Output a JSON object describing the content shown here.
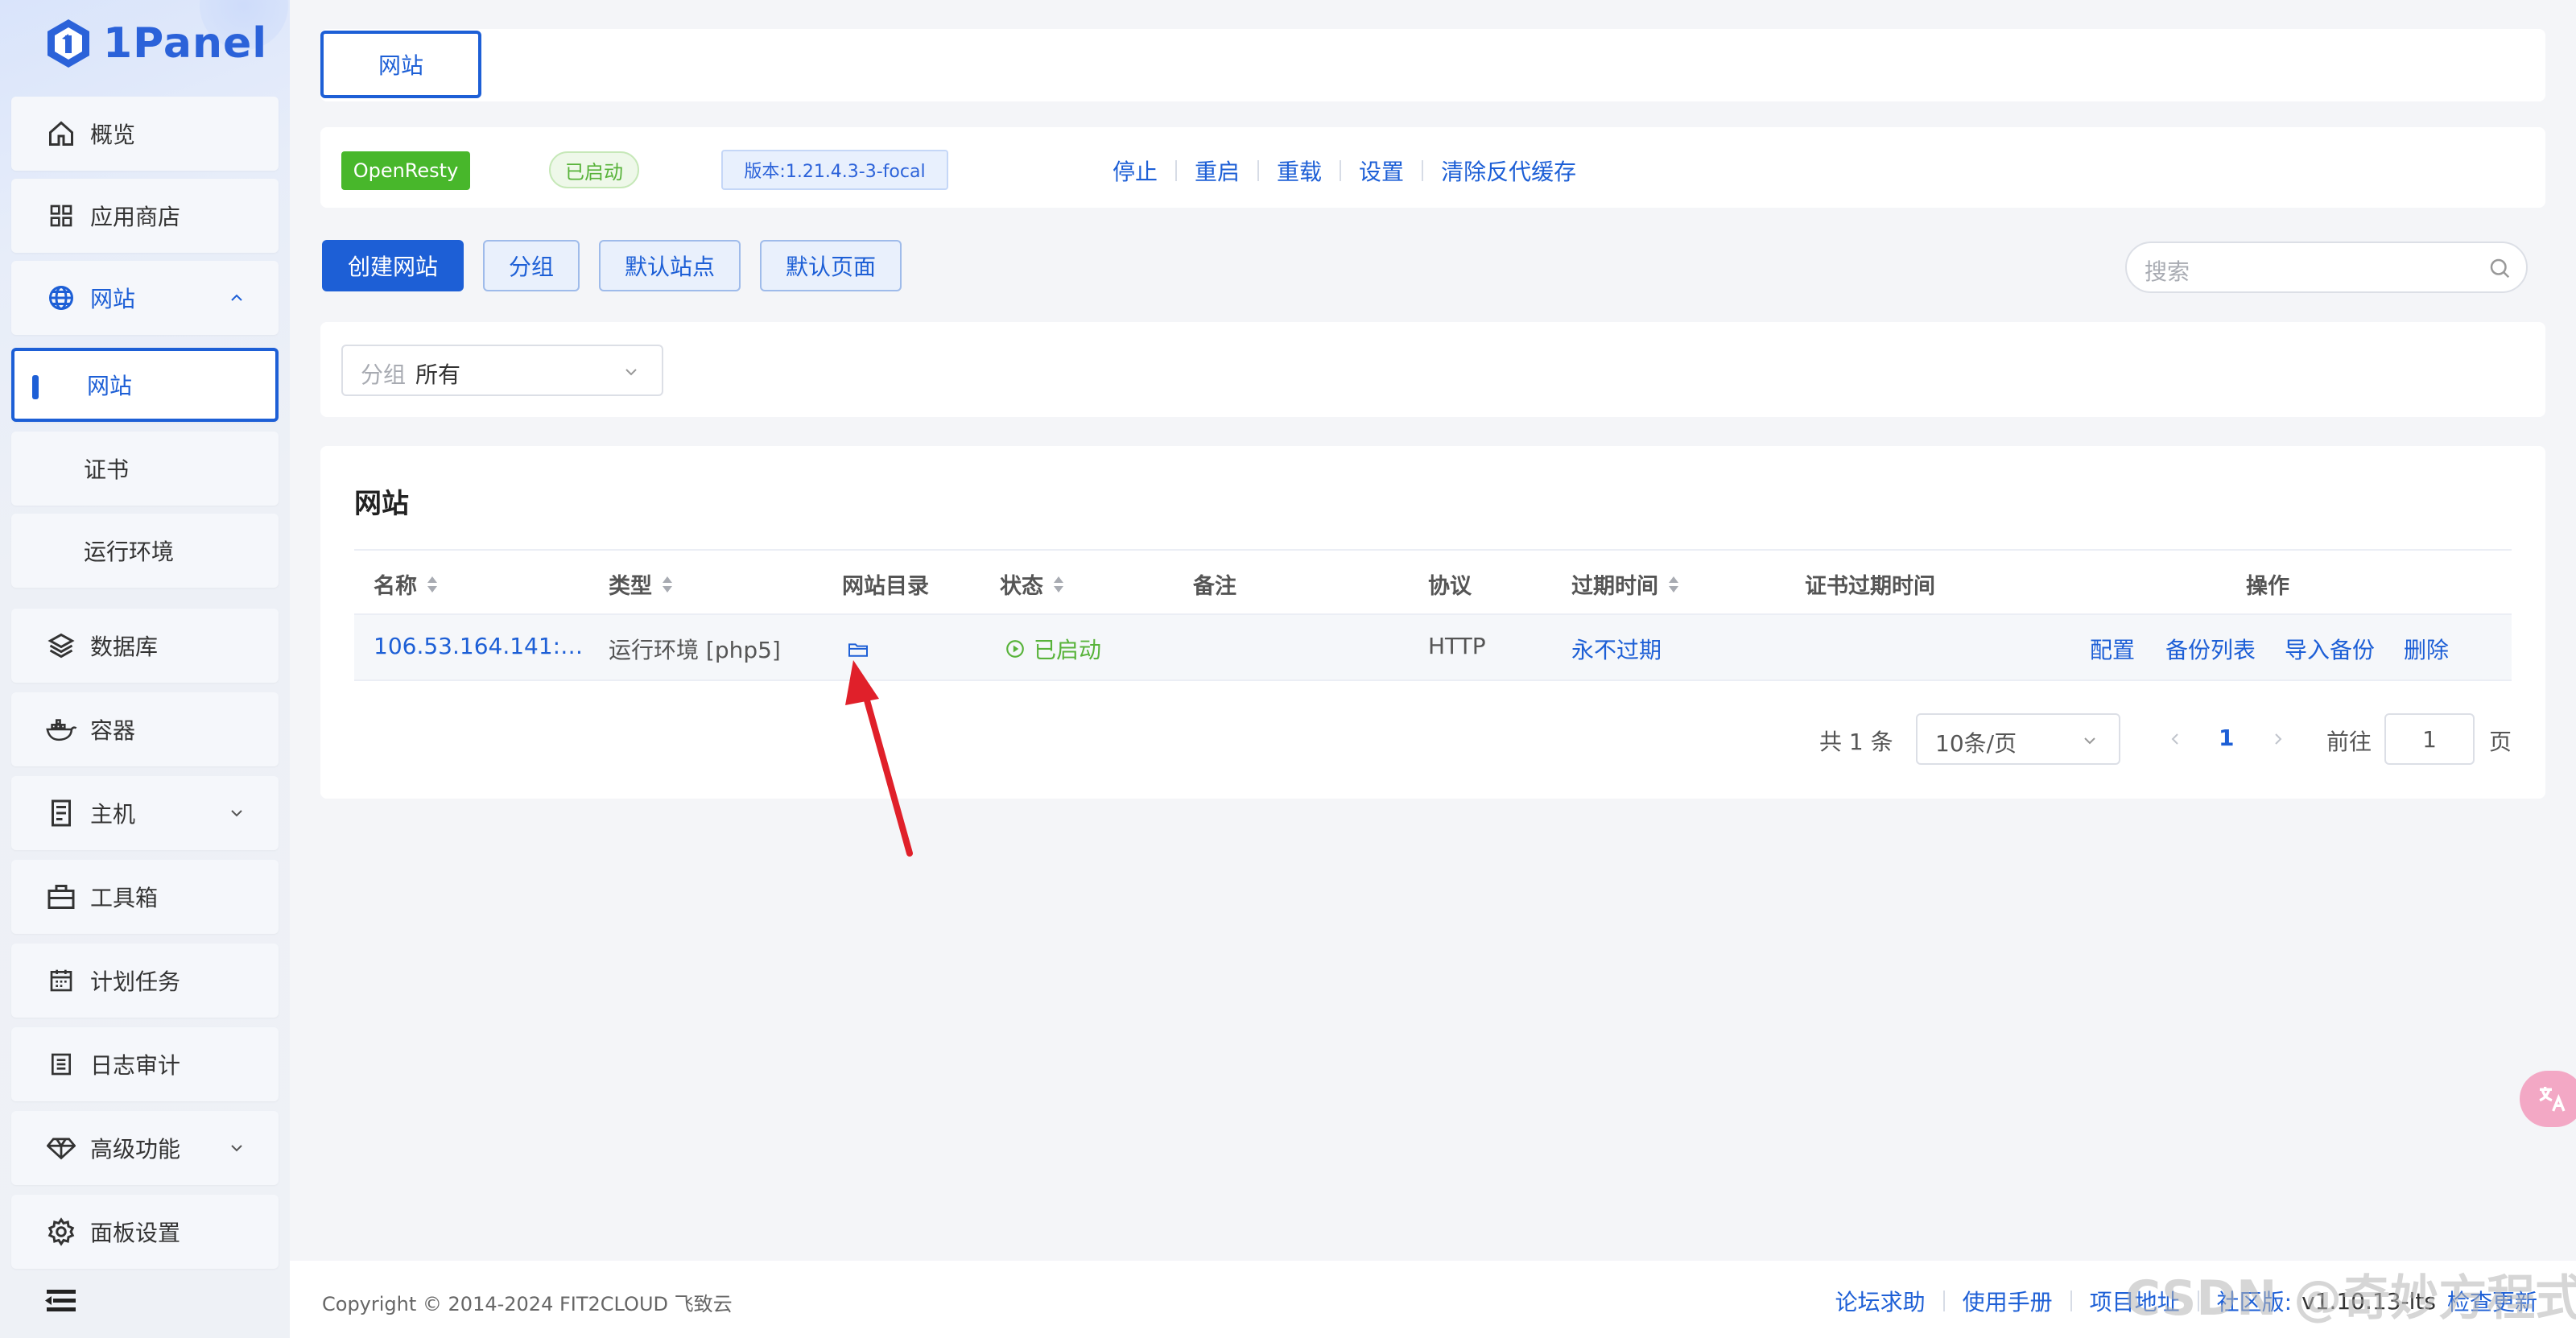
{
  "brand": {
    "name": "1Panel"
  },
  "sidebar": {
    "items": [
      {
        "label": "概览",
        "icon": "home-icon"
      },
      {
        "label": "应用商店",
        "icon": "grid-icon"
      },
      {
        "label": "网站",
        "icon": "globe-icon",
        "expanded": true
      },
      {
        "label": "网站",
        "sub": true,
        "active": true
      },
      {
        "label": "证书",
        "sub": true
      },
      {
        "label": "运行环境",
        "sub": true
      },
      {
        "label": "数据库",
        "icon": "layers-icon"
      },
      {
        "label": "容器",
        "icon": "docker-icon"
      },
      {
        "label": "主机",
        "icon": "server-icon",
        "has_children": true
      },
      {
        "label": "工具箱",
        "icon": "toolbox-icon"
      },
      {
        "label": "计划任务",
        "icon": "calendar-icon"
      },
      {
        "label": "日志审计",
        "icon": "log-icon"
      },
      {
        "label": "高级功能",
        "icon": "diamond-icon",
        "has_children": true
      },
      {
        "label": "面板设置",
        "icon": "gear-icon"
      }
    ]
  },
  "tabs": [
    {
      "label": "网站",
      "active": true
    }
  ],
  "app": {
    "name": "OpenResty",
    "status": "已启动",
    "version": "版本:1.21.4.3-3-focal",
    "actions": [
      "停止",
      "重启",
      "重载",
      "设置",
      "清除反代缓存"
    ]
  },
  "toolbar": {
    "create": "创建网站",
    "group": "分组",
    "default_site": "默认站点",
    "default_page": "默认页面",
    "search_placeholder": "搜索"
  },
  "filter": {
    "prefix": "分组",
    "value": "所有"
  },
  "table": {
    "title": "网站",
    "columns": [
      "名称",
      "类型",
      "网站目录",
      "状态",
      "备注",
      "协议",
      "过期时间",
      "证书过期时间",
      "操作"
    ],
    "rows": [
      {
        "name": "106.53.164.141:…",
        "type": "运行环境 [php5]",
        "status": "已启动",
        "remark": "",
        "protocol": "HTTP",
        "expire": "永不过期",
        "cert_expire": "",
        "actions": [
          "配置",
          "备份列表",
          "导入备份",
          "删除"
        ]
      }
    ]
  },
  "pagination": {
    "total": "共 1 条",
    "page_size": "10条/页",
    "current": "1",
    "goto_label": "前往",
    "goto_value": "1",
    "page_suffix": "页"
  },
  "footer": {
    "copyright": "Copyright © 2014-2024 FIT2CLOUD 飞致云",
    "links": [
      "论坛求助",
      "使用手册",
      "项目地址"
    ],
    "edition_label": "社区版:",
    "version": "v1.10.13-lts",
    "check_update": "检查更新"
  },
  "watermark": "CSDN @奇妙方程式",
  "colors": {
    "primary": "#1d5fd6",
    "success": "#48b72b",
    "annotation_arrow": "#e0202a"
  }
}
